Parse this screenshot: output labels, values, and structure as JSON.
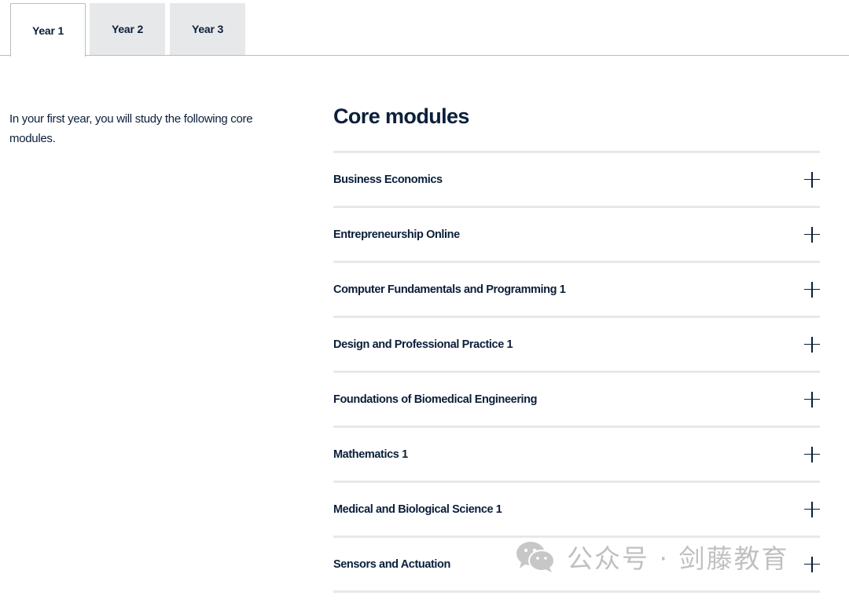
{
  "tabs": [
    {
      "label": "Year 1",
      "active": true
    },
    {
      "label": "Year 2",
      "active": false
    },
    {
      "label": "Year 3",
      "active": false
    }
  ],
  "intro": {
    "text": "In your first year, you will study the following core modules."
  },
  "core_modules": {
    "title": "Core modules",
    "items": [
      {
        "label": "Business Economics",
        "icon": "plus-icon"
      },
      {
        "label": "Entrepreneurship Online",
        "icon": "plus-icon"
      },
      {
        "label": "Computer Fundamentals and Programming 1",
        "icon": "plus-icon"
      },
      {
        "label": "Design and Professional Practice 1",
        "icon": "plus-icon"
      },
      {
        "label": "Foundations of Biomedical Engineering",
        "icon": "plus-icon"
      },
      {
        "label": "Mathematics 1",
        "icon": "plus-icon"
      },
      {
        "label": "Medical and Biological Science 1",
        "icon": "plus-icon"
      },
      {
        "label": "Sensors and Actuation",
        "icon": "plus-icon"
      }
    ]
  },
  "watermark": {
    "text": "公众号 · 剑藤教育",
    "icon": "wechat-icon"
  },
  "colors": {
    "text": "#0b1f3a",
    "tab_inactive_bg": "#e6e8ea",
    "divider": "#e6e8ea",
    "tab_border": "#b9bcbf"
  }
}
